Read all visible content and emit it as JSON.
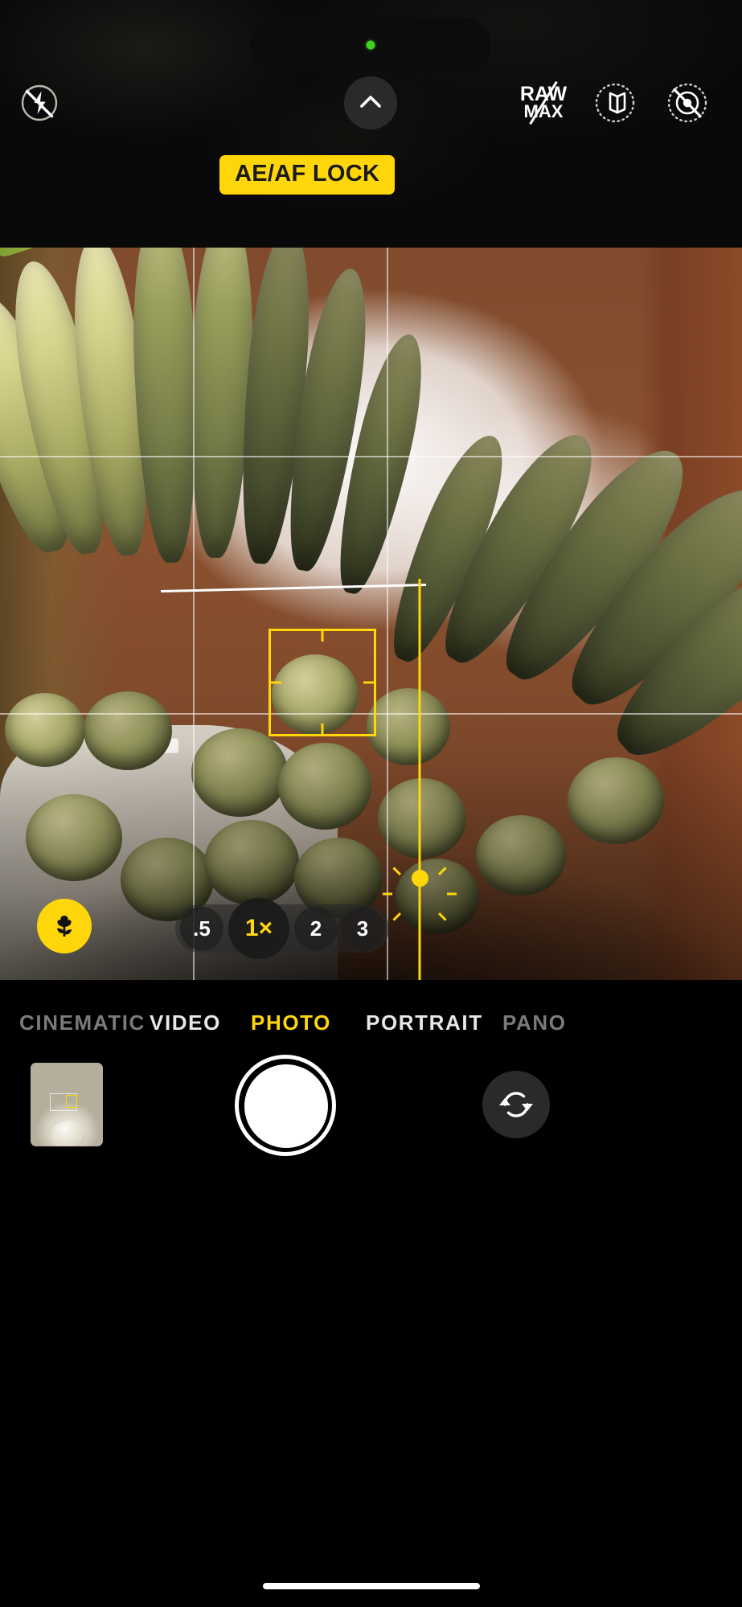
{
  "app": {
    "name": "Camera",
    "platform": "iOS",
    "accent_color": "#ffd60a",
    "background_color": "#000000"
  },
  "status_bar": {
    "camera_in_use_indicator": "●",
    "indicator_color": "#3fd11f"
  },
  "top_controls": {
    "flash": {
      "name": "flash-off-icon",
      "state": "off",
      "label": "Flash off"
    },
    "expand_chevron": {
      "name": "chevron-up-icon",
      "label": "Show more controls",
      "glyph": "⌃"
    },
    "raw": {
      "line1": "RAW",
      "line2": "MAX",
      "state": "off",
      "label": "RAW MAX off"
    },
    "night_stack": {
      "name": "photographic-styles-icon",
      "label": "Photographic Styles",
      "state": "on"
    },
    "live_photo": {
      "name": "live-photo-off-icon",
      "label": "Live Photo off",
      "state": "off"
    }
  },
  "exposure_lock": {
    "badge_text": "AE/AF LOCK",
    "background": "#ffd60a",
    "text_color": "#1a1a1a"
  },
  "viewfinder": {
    "grid_enabled": true,
    "level_line_visible": true,
    "focus_box": {
      "label": "focus-and-exposure-box",
      "color": "#ffd60a"
    },
    "exposure_slider": {
      "label": "exposure-slider",
      "icon": "sun-icon",
      "color": "#ffd60a",
      "value_position_percent": 73
    },
    "subject": "cactus plant in white pot on windowsill"
  },
  "zoom_control": {
    "options": [
      {
        "label": ".5",
        "value": "0.5x",
        "selected": false
      },
      {
        "label": "1×",
        "value": "1x",
        "selected": true
      },
      {
        "label": "2",
        "value": "2x",
        "selected": false
      },
      {
        "label": "3",
        "value": "3x",
        "selected": false
      }
    ],
    "selected_label": "1×"
  },
  "macro_control": {
    "name": "macro-flower-icon",
    "label": "Macro on",
    "state": "on",
    "color": "#ffd60a"
  },
  "mode_selector": {
    "modes": [
      {
        "label": "CINEMATIC",
        "selected": false,
        "dimmed": true
      },
      {
        "label": "VIDEO",
        "selected": false,
        "dimmed": false
      },
      {
        "label": "PHOTO",
        "selected": true,
        "dimmed": false
      },
      {
        "label": "PORTRAIT",
        "selected": false,
        "dimmed": false
      },
      {
        "label": "PANO",
        "selected": false,
        "dimmed": true
      }
    ],
    "selected_label": "PHOTO"
  },
  "bottom_controls": {
    "thumbnail": {
      "name": "photo-library-thumbnail",
      "label": "Last photo: cactus in white pot"
    },
    "shutter": {
      "name": "shutter-button",
      "label": "Take photo"
    },
    "flip_camera": {
      "name": "flip-camera-icon",
      "label": "Switch camera"
    }
  },
  "home_indicator": {
    "label": "home-indicator"
  }
}
